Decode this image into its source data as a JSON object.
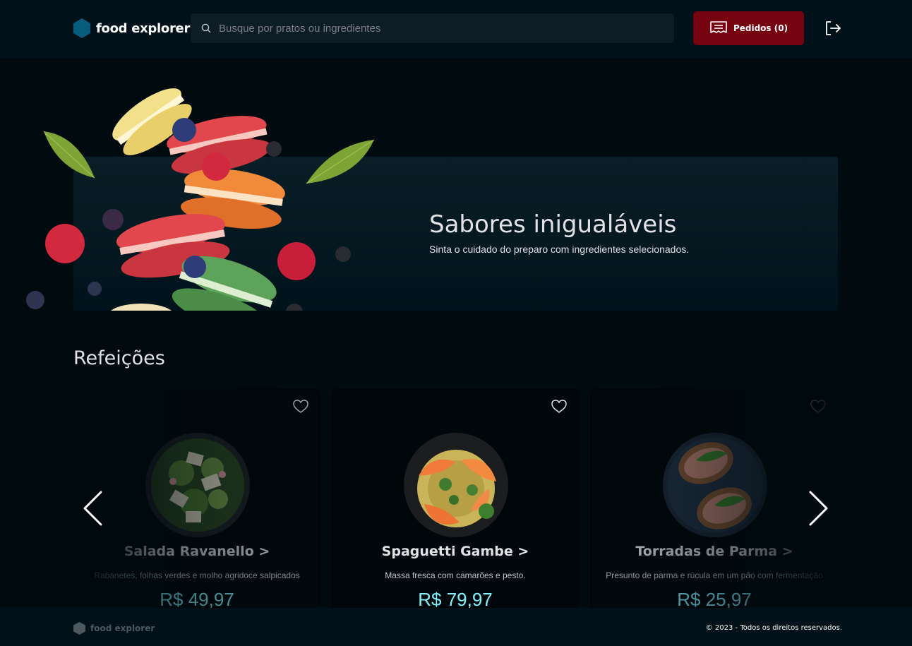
{
  "header": {
    "logo_text": "food explorer",
    "search_placeholder": "Busque por pratos ou ingredientes",
    "orders_label": "Pedidos (0)"
  },
  "banner": {
    "title": "Sabores inigualáveis",
    "subtitle": "Sinta o cuidado do preparo com ingredientes selecionados."
  },
  "section": {
    "title": "Refeições",
    "cards": [
      {
        "name": "Salada Ravanello >",
        "description": "Rabanetes, folhas verdes e molho agridoce salpicados",
        "price": "R$ 49,97"
      },
      {
        "name": "Spaguetti Gambe >",
        "description": "Massa fresca com camarões e pesto.",
        "price": "R$ 79,97"
      },
      {
        "name": "Torradas de Parma >",
        "description": "Presunto de parma e rúcula em um pão com fermentação",
        "price": "R$ 25,97"
      }
    ]
  },
  "footer": {
    "logo_text": "food explorer",
    "copyright": "© 2023 - Todos os direitos reservados."
  },
  "colors": {
    "accent_button": "#750310",
    "price": "#82F3FF",
    "logo_hex": "#065E7C"
  }
}
